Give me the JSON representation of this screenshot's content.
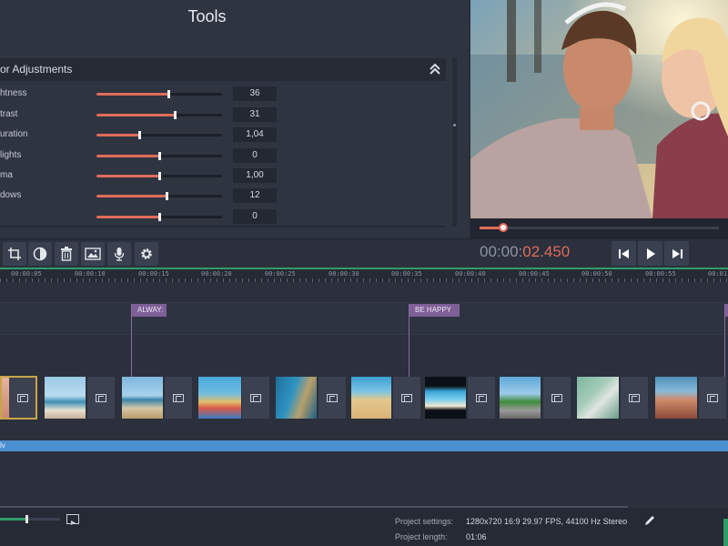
{
  "tools": {
    "title": "Tools",
    "panel_title": "or Adjustments",
    "adjustments": [
      {
        "label": "htness",
        "value": "36",
        "level": 0.57
      },
      {
        "label": "trast",
        "value": "31",
        "level": 0.62
      },
      {
        "label": "uration",
        "value": "1,04",
        "level": 0.34
      },
      {
        "label": "lights",
        "value": "0",
        "level": 0.5
      },
      {
        "label": "ma",
        "value": "1,00",
        "level": 0.5
      },
      {
        "label": "dows",
        "value": "12",
        "level": 0.56
      },
      {
        "label": "",
        "value": "0",
        "level": 0.5
      }
    ]
  },
  "toolbar": {
    "icons": [
      "crop-icon",
      "color-adjust-icon",
      "trash-icon",
      "image-icon",
      "microphone-icon",
      "gear-icon"
    ]
  },
  "player": {
    "timecode_base": "00:00:",
    "timecode_current": "02.450",
    "progress": 0.1
  },
  "ruler": {
    "ticks": [
      "00:00:05",
      "00:00:10",
      "00:00:15",
      "00:00:20",
      "00:00:25",
      "00:00:30",
      "00:00:35",
      "00:00:40",
      "00:00:45",
      "00:00:50",
      "00:00:55",
      "00:01"
    ]
  },
  "timeline": {
    "titles": [
      {
        "label": "ALWAY:"
      },
      {
        "label": "BE HAPPY"
      }
    ],
    "audio_label": "lv"
  },
  "status": {
    "settings_label": "Project settings:",
    "settings_value": "1280x720 16:9 29.97 FPS, 44100 Hz Stereo",
    "length_label": "Project length:",
    "length_value": "01:06",
    "zoom_level": 0.43
  },
  "colors": {
    "accent": "#e06c5a",
    "timeline_green": "#2f9c68",
    "title_purple": "#7e5f96",
    "audio_blue": "#4a8fd0",
    "selection": "#c7a54a"
  }
}
